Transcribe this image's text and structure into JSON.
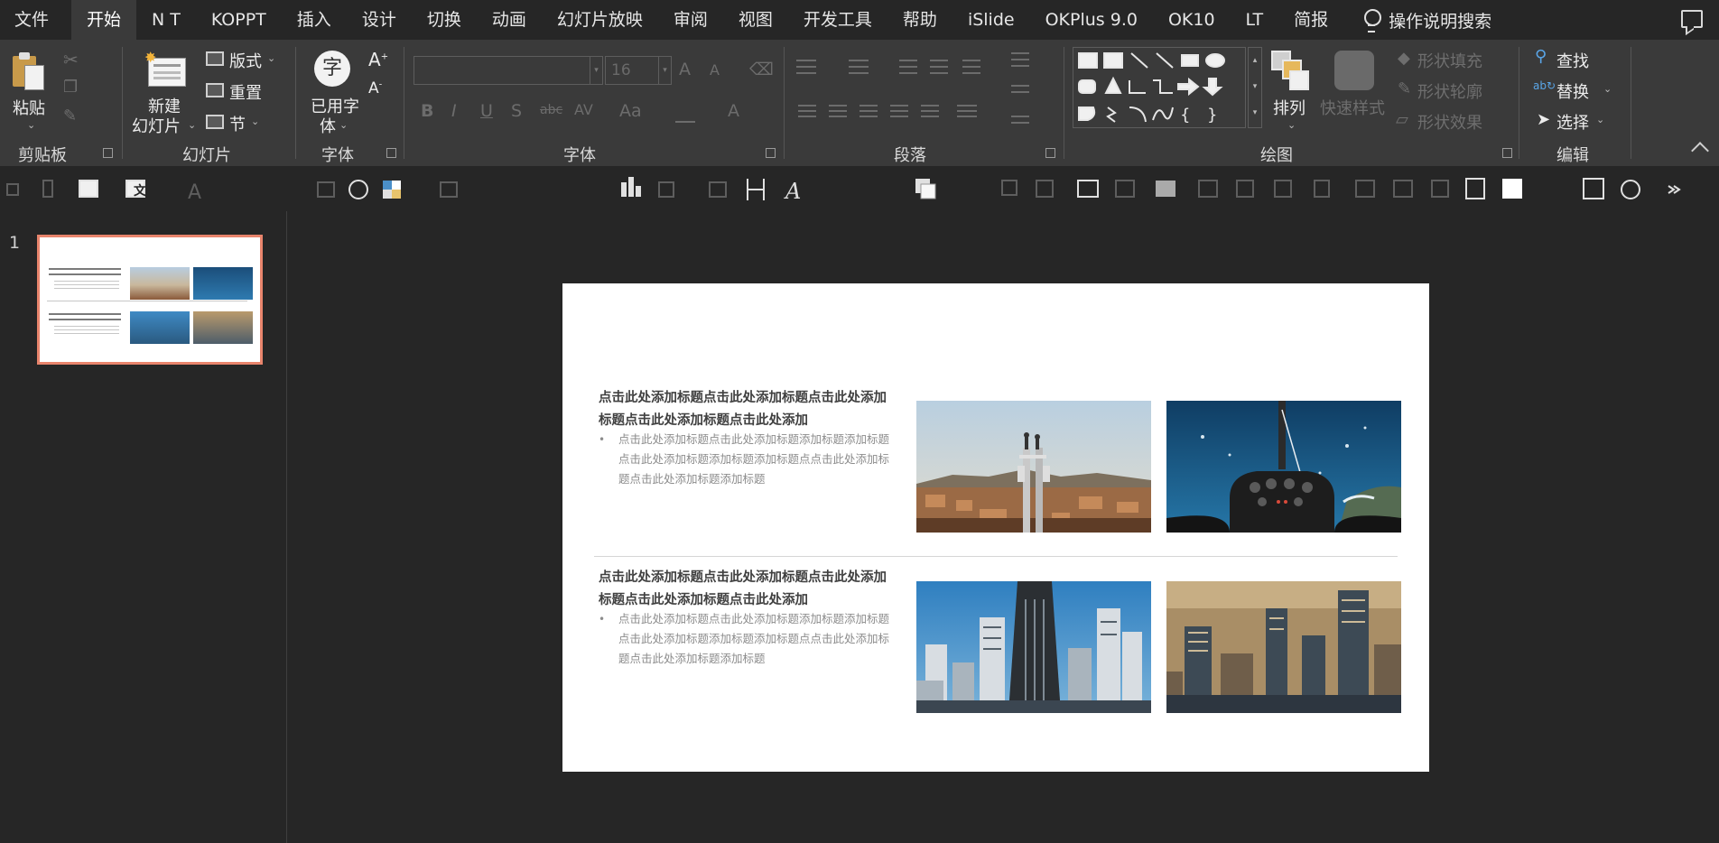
{
  "menu": {
    "file": "文件",
    "tabs": [
      "开始",
      "N T",
      "KOPPT",
      "插入",
      "设计",
      "切换",
      "动画",
      "幻灯片放映",
      "审阅",
      "视图",
      "开发工具",
      "帮助",
      "iSlide",
      "OKPlus 9.0",
      "OK10",
      "LT",
      "简报"
    ],
    "search": "操作说明搜索"
  },
  "ribbon": {
    "clipboard": {
      "paste": "粘贴",
      "label": "剪贴板"
    },
    "slides": {
      "new_slide_line1": "新建",
      "new_slide_line2": "幻灯片",
      "layout": "版式",
      "reset": "重置",
      "section": "节",
      "label": "幻灯片"
    },
    "used_font": {
      "icon_char": "字",
      "line1": "已用字",
      "line2": "体",
      "label": "字体"
    },
    "font": {
      "size": "16",
      "label": "字体"
    },
    "paragraph": {
      "label": "段落"
    },
    "drawing": {
      "arrange": "排列",
      "quick_styles": "快速样式",
      "shape_fill": "形状填充",
      "shape_outline": "形状轮廓",
      "shape_effects": "形状效果",
      "label": "绘图"
    },
    "editing": {
      "find": "查找",
      "replace": "替换",
      "select": "选择",
      "label": "编辑"
    }
  },
  "thumbnails": {
    "slide_number": "1"
  },
  "slide": {
    "section1": {
      "title": "点击此处添加标题点击此处添加标题点击此处添加标题点击此处添加标题点击此处添加",
      "bullet": "点击此处添加标题点击此处添加标题添加标题添加标题点击此处添加标题添加标题添加标题点点击此处添加标题点击此处添加标题添加标题"
    },
    "section2": {
      "title": "点击此处添加标题点击此处添加标题点击此处添加标题点击此处添加标题点击此处添加",
      "bullet": "点击此处添加标题点击此处添加标题添加标题添加标题点击此处添加标题添加标题添加标题点点击此处添加标题点击此处添加标题添加标题"
    }
  },
  "colors": {
    "thumb_border": "#e8846c",
    "ribbon_bg": "#3a3a3a",
    "app_bg": "#262626"
  }
}
